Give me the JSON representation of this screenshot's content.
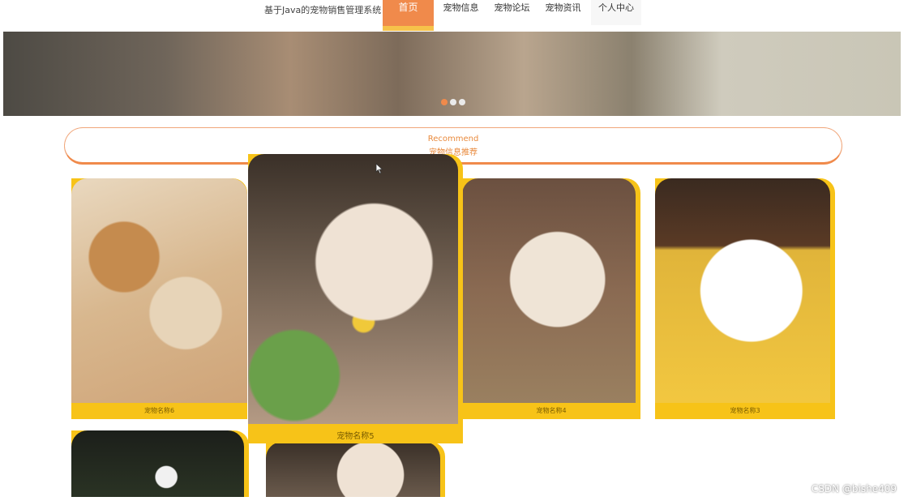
{
  "header": {
    "site_title": "基于Java的宠物销售管理系统",
    "nav": [
      {
        "label": "首页",
        "active": true
      },
      {
        "label": "宠物信息"
      },
      {
        "label": "宠物论坛"
      },
      {
        "label": "宠物资讯"
      },
      {
        "label": "个人中心"
      }
    ]
  },
  "banner": {
    "slide_count": 3,
    "active_slide": 1
  },
  "recommend": {
    "title_en": "Recommend",
    "title_cn": "宠物信息推荐"
  },
  "cards": [
    {
      "caption": "宠物名称6"
    },
    {
      "caption": "宠物名称5"
    },
    {
      "caption": "宠物名称4"
    },
    {
      "caption": "宠物名称3"
    }
  ],
  "colors": {
    "accent": "#f08a4b",
    "card": "#f7c318",
    "text_accent": "#e98a3d"
  },
  "watermark": "CSDN @bishe409"
}
